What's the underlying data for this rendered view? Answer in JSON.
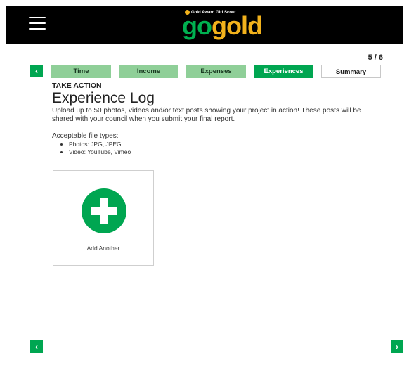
{
  "header": {
    "logo_tagline": "Gold Award Girl Scout",
    "logo_go": "go",
    "logo_gold": "gold"
  },
  "progress": {
    "step_count": "5 / 6",
    "steps": [
      {
        "label": "Time",
        "state": "done"
      },
      {
        "label": "Income",
        "state": "done"
      },
      {
        "label": "Expenses",
        "state": "done"
      },
      {
        "label": "Experiences",
        "state": "active"
      },
      {
        "label": "Summary",
        "state": "todo"
      }
    ]
  },
  "nav": {
    "prev_glyph": "‹",
    "next_glyph": "›"
  },
  "content": {
    "eyebrow": "TAKE ACTION",
    "title": "Experience Log",
    "description": "Upload up to 50 photos, videos and/or text posts showing your project in action! These posts will be shared with your council when you submit your final report.",
    "filetypes_heading": "Acceptable file types:",
    "filetypes": [
      "Photos: JPG, JPEG",
      "Video: YouTube, Vimeo"
    ]
  },
  "add_card": {
    "label": "Add Another"
  },
  "colors": {
    "brand_green": "#00a651",
    "done_step": "#8fcf98",
    "gold": "#f2b21c"
  }
}
